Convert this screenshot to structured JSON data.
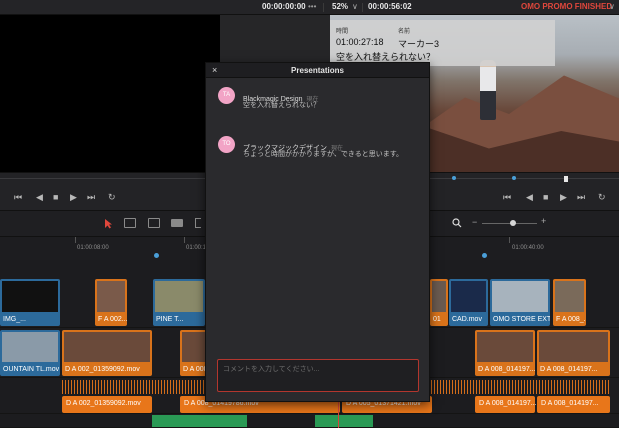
{
  "topbar": {
    "timecode_left": "00:00:00:00",
    "more": "•••",
    "zoom": "52%",
    "zoom_chevron": "∨",
    "timecode_right": "00:00:56:02",
    "project_title": "OMO PROMO FINISHED",
    "project_chevron": "∨"
  },
  "marker_overlay": {
    "time_label": "時間",
    "name_label": "名前",
    "time_value": "01:00:27:18",
    "name_value": "マーカー3",
    "note": "空を入れ替えられない？"
  },
  "dialog": {
    "title": "Presentations",
    "close": "×",
    "messages": [
      {
        "initials": "TA",
        "author": "Blackmagic Design",
        "time": "現在",
        "text": "空を入れ替えられない？"
      },
      {
        "initials": "TO",
        "author": "ブラックマジックデザイン",
        "time": "現在",
        "text": "ちょっと時間がかかりますが、できると思います。"
      }
    ],
    "input_placeholder": "コメントを入力してください..."
  },
  "transport": {
    "left": [
      "⏮",
      "◀",
      "■",
      "▶",
      "⏭",
      "↻"
    ],
    "right": [
      "⏮",
      "◀",
      "■",
      "▶",
      "⏭",
      "↻"
    ]
  },
  "ruler": {
    "labels": [
      "01:00:08:00",
      "01:00:1",
      "01:00:40:00"
    ]
  },
  "timeline": {
    "video_top": [
      {
        "name": "IMG_..."
      },
      {
        "name": "F A 002..."
      },
      {
        "name": "PINE T..."
      },
      {
        "name": "01"
      },
      {
        "name": "CAD.mov"
      },
      {
        "name": "OMO STORE EXT F..."
      },
      {
        "name": "F A 008_..."
      }
    ],
    "video_bottom": [
      {
        "name": "OUNTAIN TL.mov"
      },
      {
        "name": "D A 002_01359092.mov"
      },
      {
        "name": "D A 008_01419786.mov"
      },
      {
        "name": "D A 008_014197..."
      },
      {
        "name": "D A 008_014197..."
      }
    ],
    "audio": [
      {
        "name": "D A 002_01359092.mov"
      },
      {
        "name": "D A 008_01419786.mov"
      },
      {
        "name": "D A 005_01371421.mov"
      },
      {
        "name": "D A 008_014197..."
      },
      {
        "name": "D A 008_014197..."
      }
    ]
  },
  "colors": {
    "accent_red": "#e0473c",
    "clip_orange": "#d9731b",
    "clip_blue": "#2c6a9b",
    "avatar_pink": "#f2a4c6"
  }
}
